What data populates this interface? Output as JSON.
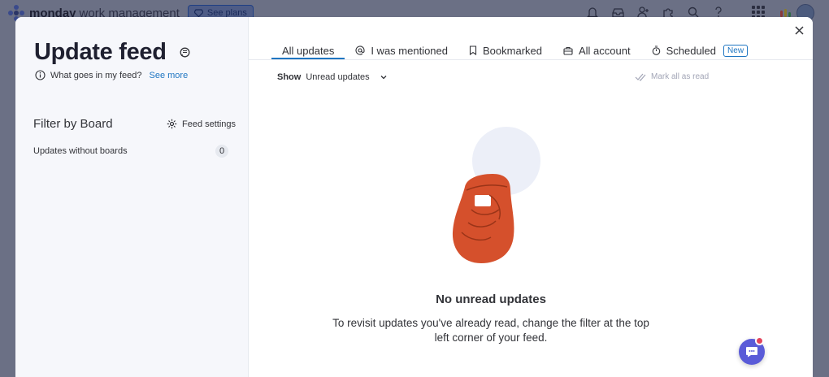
{
  "app": {
    "brand": "monday",
    "brand_sub": "work management",
    "see_plans_label": "See plans"
  },
  "header_icons": [
    "bell-icon",
    "inbox-icon",
    "invite-icon",
    "apps-puzzle-icon",
    "search-icon",
    "help-icon"
  ],
  "modal": {
    "title": "Update feed",
    "info_text": "What goes in my feed?",
    "see_more": "See more",
    "filter_title": "Filter by Board",
    "feed_settings": "Feed settings",
    "boards": [
      {
        "label": "Updates without boards",
        "count": "0"
      }
    ],
    "tabs": [
      {
        "label": "All updates",
        "icon": "",
        "active": true
      },
      {
        "label": "I was mentioned",
        "icon": "at-icon",
        "active": false
      },
      {
        "label": "Bookmarked",
        "icon": "bookmark-icon",
        "active": false
      },
      {
        "label": "All account",
        "icon": "briefcase-icon",
        "active": false
      },
      {
        "label": "Scheduled",
        "icon": "timer-icon",
        "active": false,
        "badge": "New"
      }
    ],
    "show_label": "Show",
    "show_value": "Unread updates",
    "mark_all_read": "Mark all as read",
    "empty_title": "No unread updates",
    "empty_desc": "To revisit updates you've already read, change the filter at the top left corner of your feed."
  },
  "colors": {
    "accent": "#1f76c2",
    "illustration_hand": "#d5502c",
    "illustration_circle": "#eceff8",
    "fab": "#5a5bd8",
    "notification_dot": "#e2445c"
  }
}
